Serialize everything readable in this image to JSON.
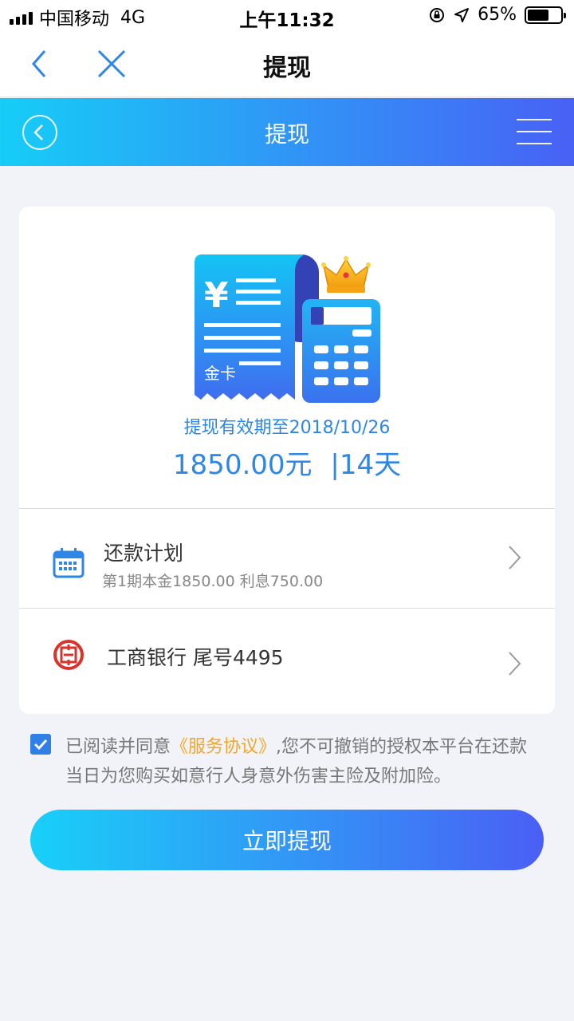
{
  "status_bar": {
    "carrier": "中国移动",
    "network": "4G",
    "time": "上午11:32",
    "battery": "65%"
  },
  "nav": {
    "title": "提现",
    "back_icon": "chevron-left-icon",
    "close_icon": "close-icon"
  },
  "header": {
    "title": "提现",
    "back_icon": "circle-back-icon",
    "menu_icon": "menu-icon"
  },
  "card": {
    "illustration_label": "金卡",
    "validity": "提现有效期至2018/10/26",
    "amount": "1850.00元",
    "separator": "|",
    "term": "14天",
    "plan": {
      "title": "还款计划",
      "subtitle": "第1期本金1850.00 利息750.00",
      "icon": "calendar-icon"
    },
    "bank": {
      "text": "工商银行 尾号4495",
      "icon": "icbc-logo-icon"
    }
  },
  "agreement": {
    "checked": true,
    "prefix": "已阅读并同意",
    "link": "《服务协议》",
    "suffix": ",您不可撤销的授权本平台在还款当日为您购买如意行人身意外伤害主险及附加险。"
  },
  "submit_label": "立即提现",
  "colors": {
    "accent_blue": "#2e86e6",
    "gradient_start": "#16cdf7",
    "gradient_end": "#4861f5",
    "link_orange": "#f5a623"
  }
}
